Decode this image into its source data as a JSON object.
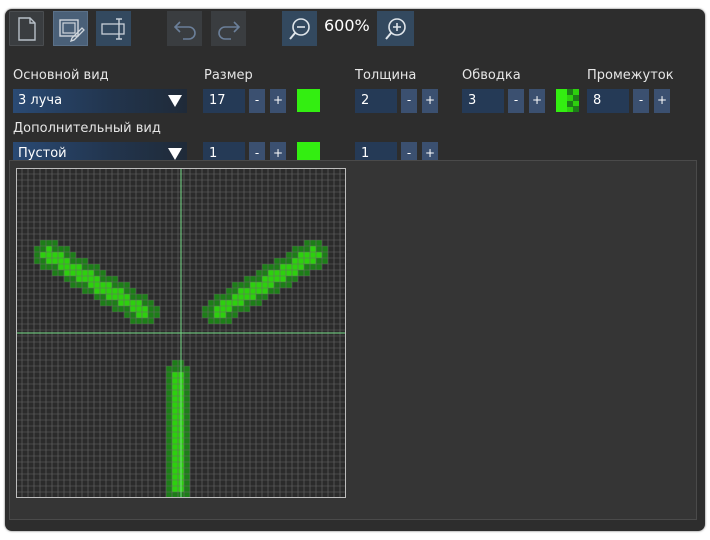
{
  "toolbar": {
    "zoom_level": "600%",
    "icons": [
      "new-document-icon",
      "edit-icon",
      "text-field-icon",
      "undo-icon",
      "redo-icon",
      "zoom-out-icon",
      "zoom-in-icon"
    ]
  },
  "row1": {
    "main_view_label": "Основной вид",
    "main_view_value": "3 луча",
    "size_label": "Размер",
    "size_value": "17",
    "thickness_label": "Толщина",
    "thickness_value": "2",
    "outline_label": "Обводка",
    "outline_value": "3",
    "gap_label": "Промежуток",
    "gap_value": "8"
  },
  "row2": {
    "extra_view_label": "Дополнительный вид",
    "extra_view_value": "Пустой",
    "size_value": "1",
    "thickness_value": "1"
  },
  "buttons": {
    "minus": "-",
    "plus": "+"
  },
  "colors": {
    "accent_green": "#33ee11",
    "fill_green": "#2dd00e",
    "outline_green": "#1d7d18",
    "grid_line": "#6a6a6a",
    "center_line": "#77dd88",
    "window_bg": "#2d2d2d"
  }
}
